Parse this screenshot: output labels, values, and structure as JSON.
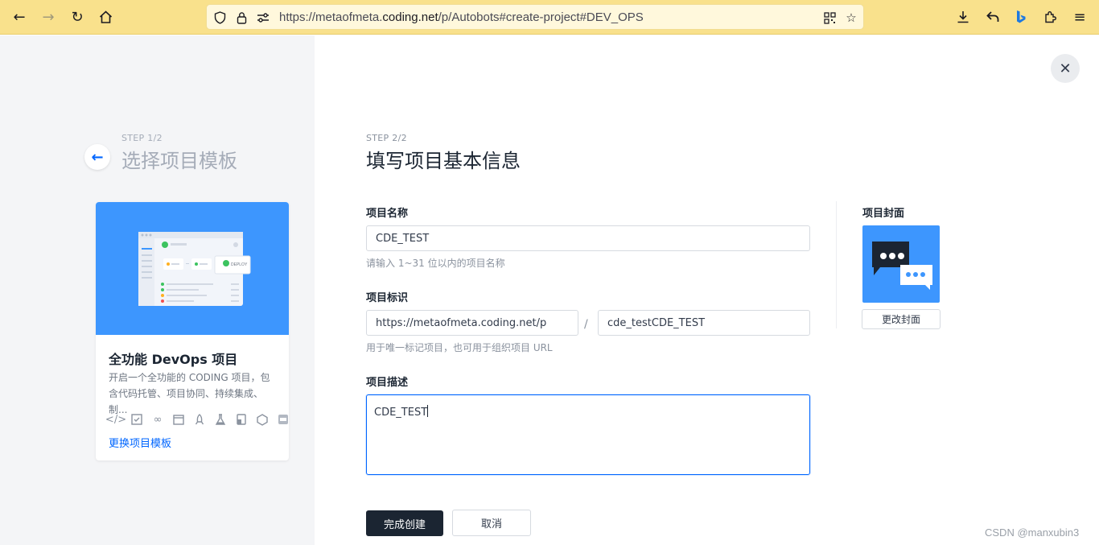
{
  "browser": {
    "url_prefix": "https://metaofmeta.",
    "url_host": "coding.net",
    "url_path": "/p/Autobots#create-project#DEV_OPS"
  },
  "left": {
    "step_label": "STEP 1/2",
    "step_title": "选择项目模板",
    "template": {
      "title": "全功能 DevOps 项目",
      "description": "开启一个全功能的 CODING 项目，包含代码托管、项目协同、持续集成、制...",
      "change_link": "更换项目模板",
      "features": [
        "code-icon",
        "tasks-icon",
        "ci-icon",
        "artifact-icon",
        "deploy-icon",
        "test-icon",
        "wiki-icon",
        "package-icon",
        "api-icon"
      ],
      "preview_label": "DEPLOY"
    }
  },
  "form": {
    "step_label": "STEP 2/2",
    "step_title": "填写项目基本信息",
    "name": {
      "label": "项目名称",
      "value": "CDE_TEST",
      "hint": "请输入 1~31 位以内的项目名称"
    },
    "identifier": {
      "label": "项目标识",
      "prefix_value": "https://metaofmeta.coding.net/p",
      "separator": "/",
      "value": "cde_testCDE_TEST",
      "hint": "用于唯一标记项目，也可用于组织项目 URL"
    },
    "description": {
      "label": "项目描述",
      "value": "CDE_TEST"
    },
    "cover": {
      "label": "项目封面",
      "change_button": "更改封面"
    },
    "submit_button": "完成创建",
    "cancel_button": "取消"
  },
  "watermark": "CSDN @manxubin3",
  "colors": {
    "accent": "#0066ff",
    "cover_blue": "#3d96fe",
    "primary_button": "#1b2532",
    "browser_toolbar": "#f9e18c"
  }
}
